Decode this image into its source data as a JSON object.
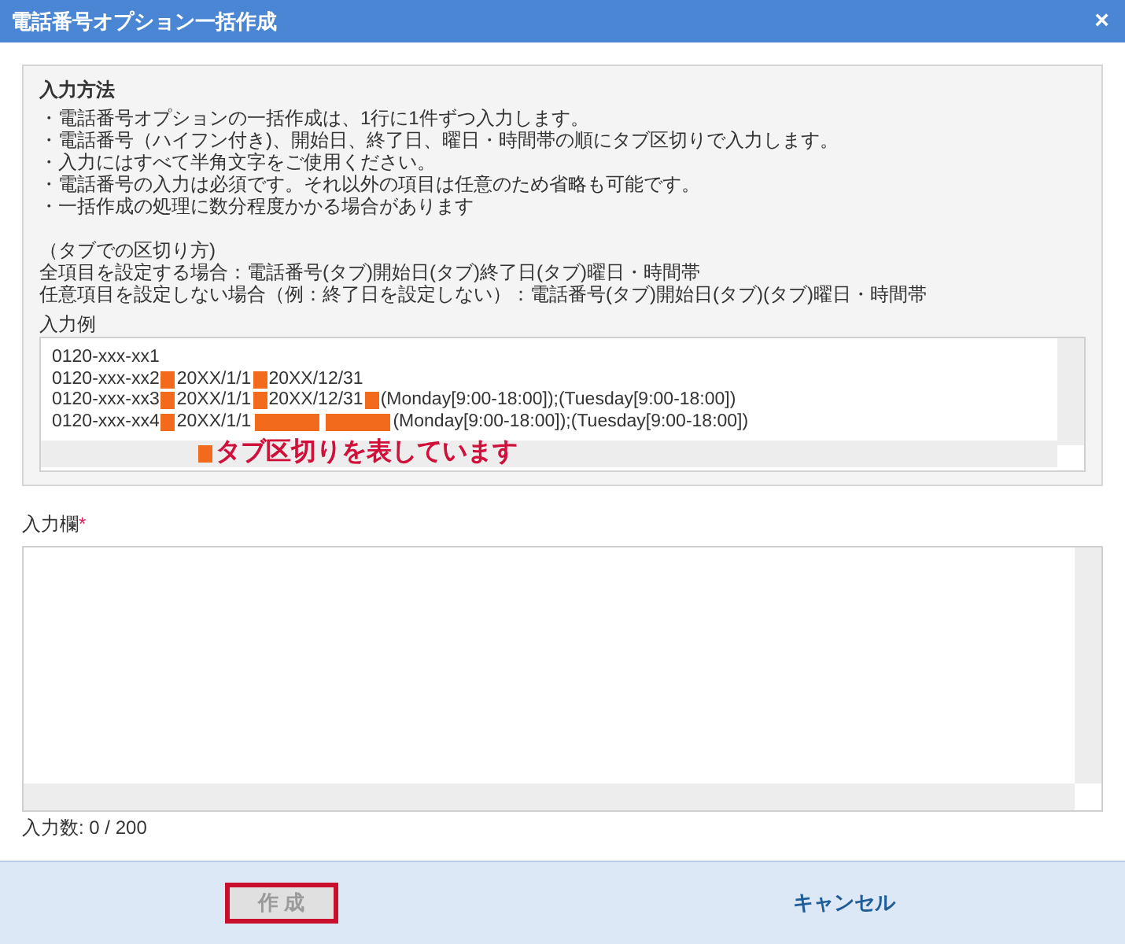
{
  "window": {
    "title": "電話番号オプション一括作成",
    "close": "×"
  },
  "instructions": {
    "heading": "入力方法",
    "bullets": [
      "・電話番号オプションの一括作成は、1行に1件ずつ入力します。",
      "・電話番号（ハイフン付き)、開始日、終了日、曜日・時間帯の順にタブ区切りで入力します。",
      "・入力にはすべて半角文字をご使用ください。",
      "・電話番号の入力は必須です。それ以外の項目は任意のため省略も可能です。",
      "・一括作成の処理に数分程度かかる場合があります"
    ],
    "tab_notes": [
      "（タブでの区切り方)",
      "全項目を設定する場合：電話番号(タブ)開始日(タブ)終了日(タブ)曜日・時間帯",
      "任意項目を設定しない場合（例：終了日を設定しない）：電話番号(タブ)開始日(タブ)(タブ)曜日・時間帯"
    ],
    "example_label": "入力例",
    "example_lines": [
      [
        {
          "kind": "text",
          "text": "0120-xxx-xx1"
        }
      ],
      [
        {
          "kind": "text",
          "text": "0120-xxx-xx2"
        },
        {
          "kind": "tab"
        },
        {
          "kind": "text",
          "text": "20XX/1/1"
        },
        {
          "kind": "tab"
        },
        {
          "kind": "text",
          "text": "20XX/12/31"
        }
      ],
      [
        {
          "kind": "text",
          "text": "0120-xxx-xx3"
        },
        {
          "kind": "tab"
        },
        {
          "kind": "text",
          "text": "20XX/1/1"
        },
        {
          "kind": "tab"
        },
        {
          "kind": "text",
          "text": "20XX/12/31"
        },
        {
          "kind": "tab"
        },
        {
          "kind": "text",
          "text": "(Monday[9:00-18:00]);(Tuesday[9:00-18:00])"
        }
      ],
      [
        {
          "kind": "text",
          "text": "0120-xxx-xx4"
        },
        {
          "kind": "tab"
        },
        {
          "kind": "text",
          "text": "20XX/1/1"
        },
        {
          "kind": "wide_tab"
        },
        {
          "kind": "wide_tab"
        },
        {
          "kind": "text",
          "text": "(Monday[9:00-18:00]);(Tuesday[9:00-18:00])"
        }
      ]
    ],
    "tab_legend": "タブ区切りを表しています"
  },
  "input": {
    "label": "入力欄",
    "required_mark": "*",
    "count": "入力数: 0 / 200"
  },
  "buttons": [
    {
      "label": "作 成",
      "kind": "primary",
      "disabled": true,
      "highlighted": true
    },
    {
      "label": "キャンセル",
      "kind": "link",
      "disabled": false,
      "highlighted": false
    }
  ]
}
